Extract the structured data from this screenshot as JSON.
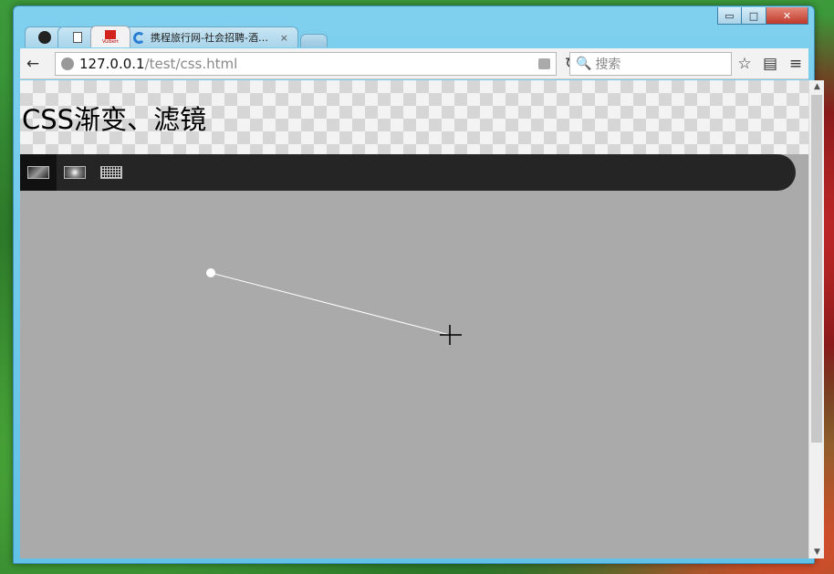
{
  "window": {
    "minimize_glyph": "▭",
    "maximize_glyph": "□",
    "close_glyph": "✕"
  },
  "tabs": [
    {
      "icon": "github-icon",
      "title": ""
    },
    {
      "icon": "blank-page-icon",
      "title": ""
    },
    {
      "icon": "ctrip-icon",
      "title": "",
      "favicon_text": "Vuibert"
    },
    {
      "icon": "swirl-icon",
      "title": "携程旅行网-社会招聘-酒…",
      "close": "×"
    }
  ],
  "toolbar": {
    "back_glyph": "←",
    "reload_glyph": "↻",
    "url_host": "127.0.0.1",
    "url_path": "/test/css.html",
    "search_icon": "🔍",
    "search_placeholder": "搜索",
    "star_glyph": "☆",
    "reader_glyph": "▤",
    "menu_glyph": "≡"
  },
  "page": {
    "title": "CSS渐变、滤镜",
    "nav_items": [
      {
        "name": "linear-gradient",
        "active": true
      },
      {
        "name": "radial-gradient",
        "active": false
      },
      {
        "name": "grid-pattern",
        "active": false
      }
    ]
  },
  "scrollbar": {
    "up_glyph": "▲",
    "down_glyph": "▼"
  },
  "colors": {
    "canvas_bg": "#aaaaaa",
    "nav_bg": "#252525",
    "line": "#ffffff"
  }
}
